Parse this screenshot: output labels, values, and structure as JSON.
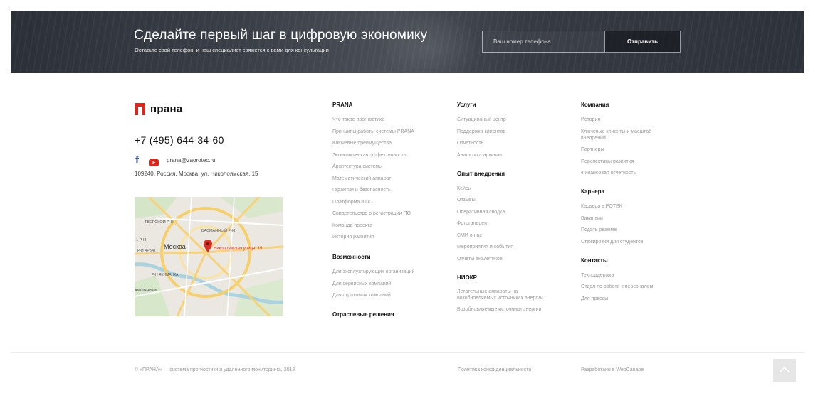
{
  "banner": {
    "title": "Сделайте первый шаг в цифровую экономику",
    "subtitle": "Оставьте свой телефон, и наш специалист свяжется с вами для консультации",
    "phone_placeholder": "Ваш номер телефона",
    "submit_label": "Отправить"
  },
  "brand": {
    "logo_text": "прана",
    "logo_color": "#e2231a",
    "phone": "+7 (495) 644-34-60",
    "email": "prana@zaorotec.ru",
    "address": "109240, Россия, Москва, ул. Николоямская, 15",
    "socials": [
      "facebook-icon",
      "youtube-icon"
    ]
  },
  "map": {
    "streets": [
      "ТВЕРСКОЙ Р-Н",
      "БАСМАННЫЙ Р-Н",
      "Москва",
      "Р-Н АРБАТ",
      "Р-Н ЯКИМАНКА",
      "АМОВНИКИ",
      "1 Р-Н"
    ],
    "marker_label": "Николоямская улица, 15",
    "marker_color": "#d93025"
  },
  "columns": {
    "prana": {
      "heading": "PRANA",
      "links": [
        "Что такое прогностика",
        "Принципы работы системы PRANA",
        "Ключевые преимущества",
        "Экономическая эффективность",
        "Архитектура системы",
        "Математический аппарат",
        "Гарантии и безопасность",
        "Платформа и ПО",
        "Свидетельства о регистрации ПО",
        "Команда проекта",
        "История развития"
      ],
      "heading2": "Возможности",
      "links2": [
        "Для эксплуатирующих организаций",
        "Для сервисных компаний",
        "Для страховых компаний"
      ],
      "heading3": "Отраслевые решения"
    },
    "services": {
      "heading": "Услуги",
      "links": [
        "Ситуационный центр",
        "Поддержка клиентов",
        "Отчетность",
        "Аналитика архивов"
      ],
      "heading2": "Опыт внедрения",
      "links2": [
        "Кейсы",
        "Отзывы",
        "Оперативная сводка",
        "Фотогалерея",
        "СМИ о нас",
        "Мероприятия и события",
        "Отчеты аналитиков"
      ],
      "heading3": "НИОКР",
      "links3": [
        "Летательные аппараты на возобновляемых источниках энергии",
        "Возобновляемые источники энергии"
      ]
    },
    "company": {
      "heading": "Компания",
      "links": [
        "История",
        "Ключевые клиенты и масштаб внедрений",
        "Партнеры",
        "Перспективы развития",
        "Финансовая отчетность"
      ],
      "heading2": "Карьера",
      "links2": [
        "Карьера в РОТЕК",
        "Вакансии",
        "Подать резюме",
        "Стажировки для студентов"
      ],
      "heading3": "Контакты",
      "links3": [
        "Техподдержка",
        "Отдел по работе с персоналом",
        "Для прессы"
      ]
    }
  },
  "footer": {
    "copyright": "© «ПРАНА» — система прогностики и удаленного мониторинга, 2018",
    "privacy": "Политика конфиденциальности",
    "developer": "Разработано в WebCanape",
    "to_top_icon": "chevron-up-icon"
  }
}
